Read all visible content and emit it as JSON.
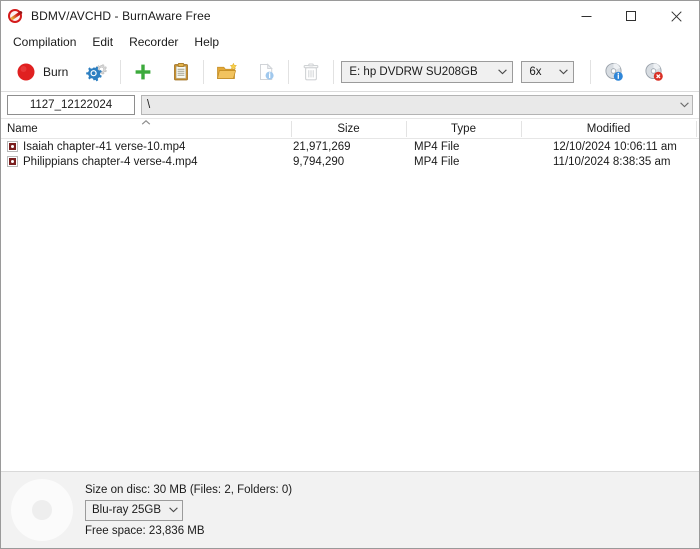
{
  "window": {
    "title": "BDMV/AVCHD - BurnAware Free",
    "app_icon": "burnaware-disc-icon",
    "controls": {
      "minimize": "minimize-icon",
      "maximize": "maximize-icon",
      "close": "close-icon"
    }
  },
  "menubar": {
    "items": [
      {
        "label": "Compilation"
      },
      {
        "label": "Edit"
      },
      {
        "label": "Recorder"
      },
      {
        "label": "Help"
      }
    ]
  },
  "toolbar": {
    "burn_label": "Burn",
    "burn_icon": "red-record-circle-icon",
    "settings_icon": "gears-icon",
    "add_icon": "green-plus-icon",
    "clipboard_icon": "clipboard-icon",
    "new_folder_icon": "new-folder-icon",
    "file_info_icon": "file-info-icon",
    "delete_icon": "trash-icon",
    "disc_info_icon": "disc-info-icon",
    "erase_disc_icon": "disc-erase-icon",
    "drive": {
      "value": "E: hp DVDRW  SU208GB",
      "options": [
        "E: hp DVDRW  SU208GB"
      ]
    },
    "speed": {
      "value": "6x",
      "options": [
        "6x"
      ]
    }
  },
  "pathrow": {
    "disc_name": "1127_12122024",
    "path": "\\"
  },
  "filelist": {
    "columns": [
      {
        "label": "Name"
      },
      {
        "label": "Size"
      },
      {
        "label": "Type"
      },
      {
        "label": "Modified"
      }
    ],
    "sort": {
      "column": "Name",
      "direction": "ascending",
      "icon": "sort-ascending-icon"
    },
    "rows": [
      {
        "icon": "mp4-file-icon",
        "name": "Isaiah chapter-41 verse-10.mp4",
        "size": "21,971,269",
        "type": "MP4 File",
        "modified": "12/10/2024 10:06:11 am"
      },
      {
        "icon": "mp4-file-icon",
        "name": "Philippians chapter-4 verse-4.mp4",
        "size": "9,794,290",
        "type": "MP4 File",
        "modified": "11/10/2024 8:38:35 am"
      }
    ]
  },
  "status": {
    "disc_graphic": "disc-graphic-icon",
    "size_on_disc": "Size on disc: 30 MB (Files: 2, Folders: 0)",
    "disc_type": {
      "value": "Blu-ray 25GB",
      "options": [
        "Blu-ray 25GB"
      ]
    },
    "free_space": "Free space: 23,836 MB"
  },
  "colors": {
    "burn_red": "#e02020",
    "gear_blue": "#2d7fc1",
    "plus_green": "#3caa3c",
    "folder_orange": "#e8a22e",
    "badge_blue": "#2f86d8",
    "badge_red": "#d93025"
  }
}
